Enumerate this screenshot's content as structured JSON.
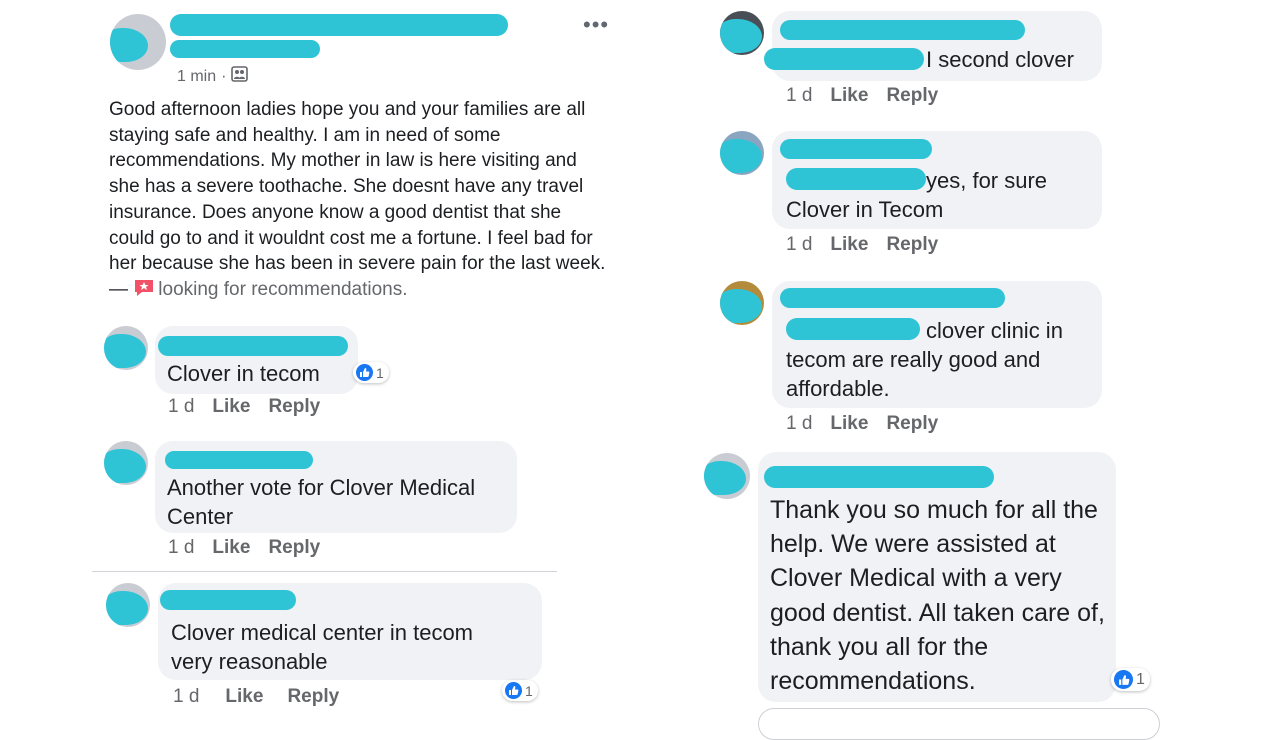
{
  "post": {
    "time": "1 min",
    "body": "Good afternoon ladies hope you and your families are all staying safe and healthy. I am in need of some recommendations. My mother in law is here visiting and she has a severe toothache. She doesnt have any travel insurance. Does anyone know a good dentist that she could go to and it wouldnt cost me a fortune. I feel bad for her because she has been in severe pain for the last week. — ",
    "tag": "looking for recommendations."
  },
  "actions": {
    "like": "Like",
    "reply": "Reply"
  },
  "left_comments": [
    {
      "text": "Clover in tecom",
      "time": "1 d",
      "reactions": "1"
    },
    {
      "text": "Another vote for Clover Medical\nCenter",
      "time": "1 d"
    },
    {
      "text": "Clover medical center in tecom\nvery reasonable",
      "time": "1 d",
      "reactions": "1"
    }
  ],
  "right_comments": [
    {
      "text": "I second clover",
      "time": "1 d"
    },
    {
      "text": "yes, for sure\nClover in Tecom",
      "time": "1 d"
    },
    {
      "text": "clover clinic in\ntecom are really good and\naffordable.",
      "time": "1 d"
    },
    {
      "text": "Thank you so much for all the\nhelp. We were assisted at\nClover Medical with a very\ngood dentist. All taken care of,\nthank you all for the\nrecommendations.",
      "reactions": "1"
    }
  ],
  "colors": {
    "accent": "#1877f2",
    "bubble": "#f0f2f5",
    "redaction": "#2ec4d6",
    "meta": "#65676b"
  },
  "icons": [
    "more-options-icon",
    "group-privacy-icon",
    "tag-badge-icon",
    "like-reaction-icon"
  ]
}
